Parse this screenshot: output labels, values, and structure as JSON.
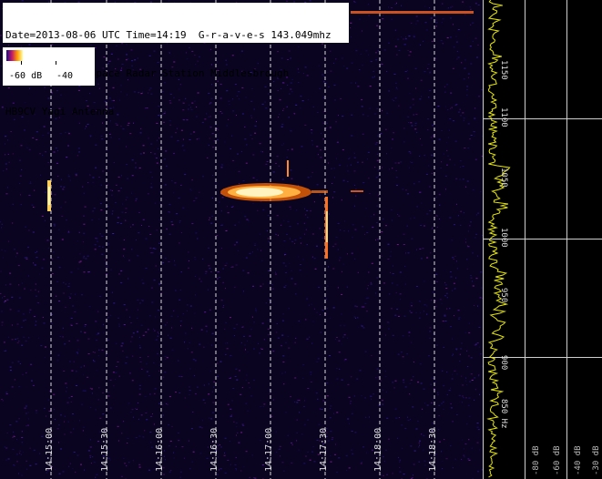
{
  "info": {
    "line1": "Date=2013-08-06 UTC Time=14:19  G-r-a-v-e-s 143.049mhz",
    "line2": "Cliffs Meteor Space Radar Station Middlesbrough",
    "line3": "HB9CV Yagi Antenna"
  },
  "legend": {
    "label_min": "-60 dB",
    "label_max": "-40"
  },
  "time_axis": {
    "labels": [
      "14:15:00",
      "14:15:30",
      "14:16:00",
      "14:16:30",
      "14:17:00",
      "14:17:30",
      "14:18:00",
      "14:18:30"
    ]
  },
  "freq_axis": {
    "labels": [
      "1150",
      "1100",
      "1050",
      "1000",
      "950",
      "900",
      "850 Hz"
    ]
  },
  "db_axis": {
    "labels": [
      "-80 dB",
      "-60 dB",
      "-40 dB",
      "-30 dB"
    ]
  },
  "colors": {
    "background": "#0a0420",
    "trace": "#e8e800",
    "gridline": "#ffffff"
  }
}
